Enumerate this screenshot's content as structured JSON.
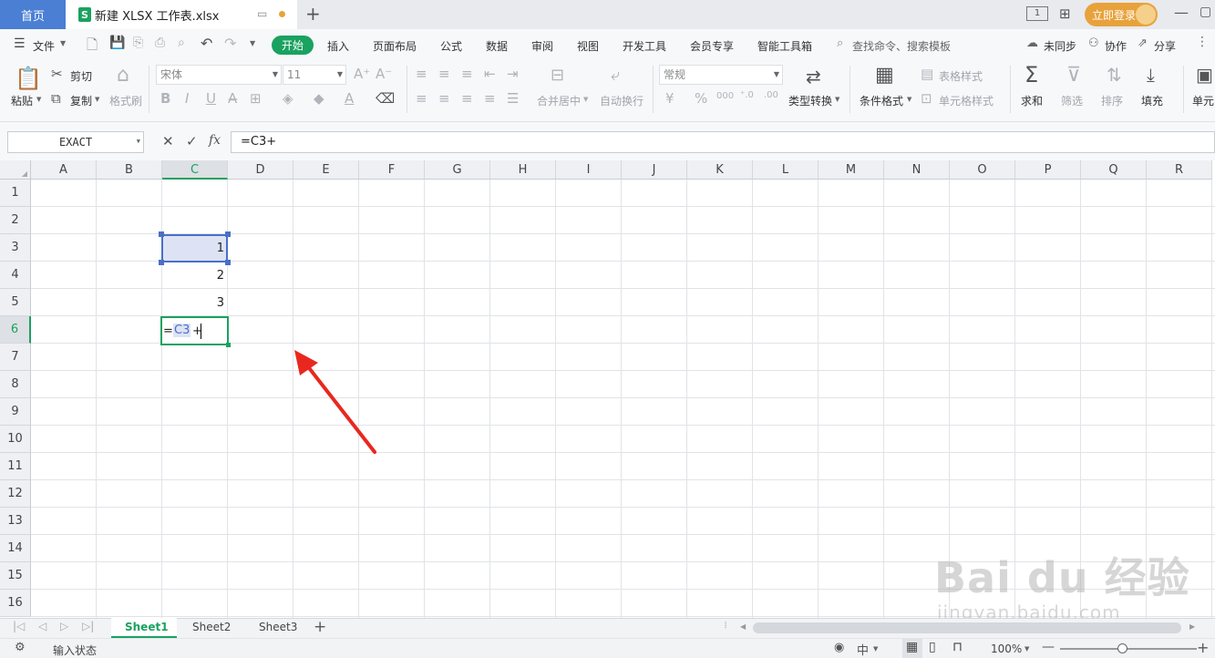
{
  "titlebar": {
    "home_tab": "首页",
    "doc_tab": "新建 XLSX 工作表.xlsx",
    "doc_icon": "S",
    "new_tab": "+",
    "login_button": "立即登录"
  },
  "menubar": {
    "file": "文件",
    "tabs": [
      "开始",
      "插入",
      "页面布局",
      "公式",
      "数据",
      "审阅",
      "视图",
      "开发工具",
      "会员专享",
      "智能工具箱"
    ],
    "search_placeholder": "查找命令、搜索模板",
    "unsynced": "未同步",
    "collaborate": "协作",
    "share": "分享"
  },
  "ribbon": {
    "paste": "粘贴",
    "cut": "剪切",
    "copy": "复制",
    "format_painter": "格式刷",
    "font_name": "宋体",
    "font_size": "11",
    "merge_center": "合并居中",
    "wrap_text": "自动换行",
    "number_format": "常规",
    "type_convert": "类型转换",
    "conditional_format": "条件格式",
    "table_style": "表格样式",
    "cell_style": "单元格样式",
    "sum": "求和",
    "filter": "筛选",
    "sort": "排序",
    "fill": "填充",
    "cell": "单元"
  },
  "formulabar": {
    "name_box": "EXACT",
    "formula": "=C3+"
  },
  "grid": {
    "columns": [
      "A",
      "B",
      "C",
      "D",
      "E",
      "F",
      "G",
      "H",
      "I",
      "J",
      "K",
      "L",
      "M",
      "N",
      "O",
      "P",
      "Q",
      "R"
    ],
    "rows": [
      "1",
      "2",
      "3",
      "4",
      "5",
      "6",
      "7",
      "8",
      "9",
      "10",
      "11",
      "12",
      "13",
      "14",
      "15",
      "16"
    ],
    "cells": {
      "C3": "1",
      "C4": "2",
      "C5": "3"
    },
    "edit_cell": {
      "eq": "=",
      "ref": "C3",
      "op": "+"
    }
  },
  "sheets": [
    "Sheet1",
    "Sheet2",
    "Sheet3"
  ],
  "statusbar": {
    "mode": "输入状态",
    "zoom": "100%"
  },
  "watermark": {
    "brand": "Bai du 经验",
    "url": "jingyan.baidu.com"
  },
  "colors": {
    "accent_green": "#1aa260",
    "home_tab_blue": "#4a7fd4",
    "login_orange": "#e8a23c",
    "arrow_red": "#e8281e",
    "ref_blue": "#4a6fc9"
  }
}
